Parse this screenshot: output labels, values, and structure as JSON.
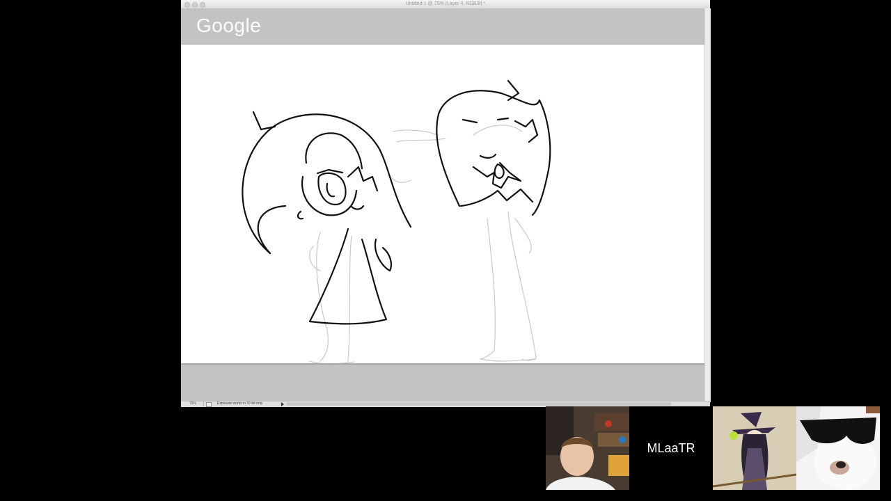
{
  "window": {
    "title": "Untitled-1 @ 75% (Layer 4, RGB/8) *"
  },
  "document": {
    "logo_text": "Google"
  },
  "statusbar": {
    "zoom": "75%",
    "info": "Exposure works in 32-bit only"
  },
  "participants": [
    {
      "name": ""
    },
    {
      "name": "MLaaTR"
    },
    {
      "name": ""
    },
    {
      "name": ""
    }
  ]
}
